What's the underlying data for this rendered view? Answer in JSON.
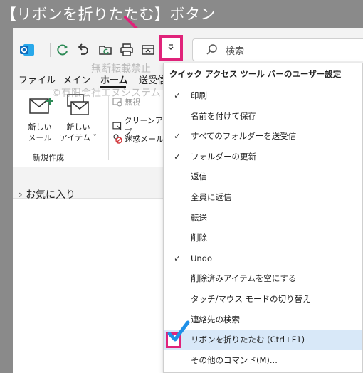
{
  "banner": {
    "title": "【リボンを折りたたむ】ボタン"
  },
  "search": {
    "placeholder": "検索"
  },
  "tabs": [
    {
      "label": "ファイル"
    },
    {
      "label": "メイン"
    },
    {
      "label": "ホーム"
    },
    {
      "label": "送受信"
    }
  ],
  "ribbon": {
    "new_mail": "新しい\nメール",
    "new_item": "新しい\nアイテム ˅",
    "group_name": "新規作成",
    "ignore": "無視",
    "cleanup": "クリーンアップ",
    "junk": "迷惑メール"
  },
  "nav": {
    "favorites": "お気に入り"
  },
  "watermark": {
    "line1": "無断転載禁止",
    "line2": "©有限会社エヌシステム"
  },
  "menu": {
    "title": "クイック アクセス ツール バーのユーザー設定",
    "items": [
      {
        "label": "印刷",
        "checked": true
      },
      {
        "label": "名前を付けて保存",
        "checked": false
      },
      {
        "label": "すべてのフォルダーを送受信",
        "checked": true
      },
      {
        "label": "フォルダーの更新",
        "checked": true
      },
      {
        "label": "返信",
        "checked": false
      },
      {
        "label": "全員に返信",
        "checked": false
      },
      {
        "label": "転送",
        "checked": false
      },
      {
        "label": "削除",
        "checked": false
      },
      {
        "label": "Undo",
        "checked": true
      },
      {
        "label": "削除済みアイテムを空にする",
        "checked": false
      },
      {
        "label": "タッチ/マウス モードの切り替え",
        "checked": false
      },
      {
        "label": "連絡先の検索",
        "checked": false
      },
      {
        "label": "リボンを折りたたむ (Ctrl+F1)",
        "checked": true
      },
      {
        "label": "その他のコマンド(M)...",
        "checked": false
      }
    ]
  },
  "colors": {
    "accent_pink": "#e0237a",
    "outlook_blue": "#0f6cbd",
    "check_blue": "#1e90e8",
    "sync_green": "#2e8b57"
  }
}
